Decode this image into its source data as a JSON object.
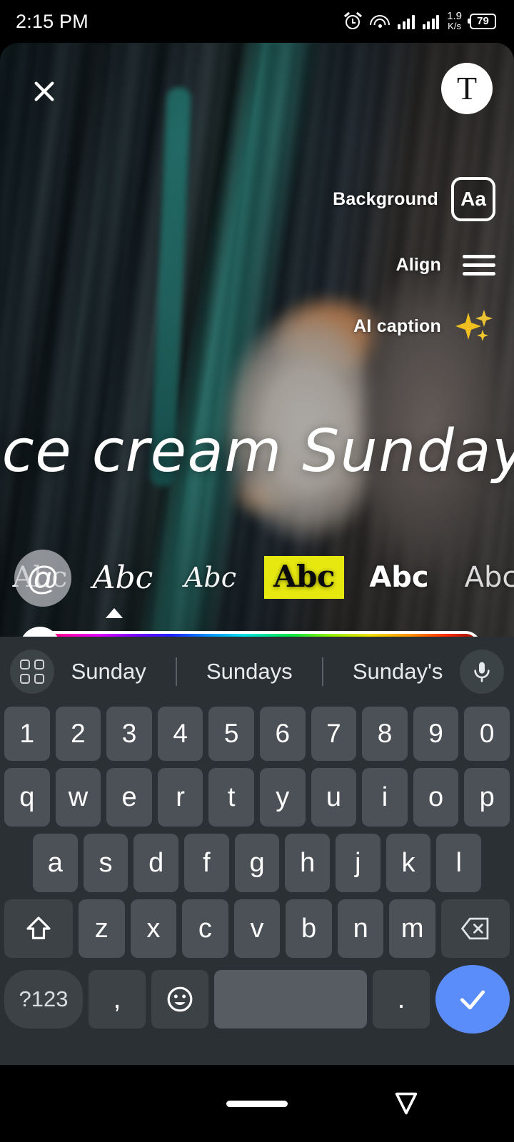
{
  "status_bar": {
    "time": "2:15 PM",
    "alarm_icon": "alarm-icon",
    "wifi_icon": "wifi-icon",
    "signal_icon": "signal-bars-icon",
    "network_speed_value": "1.9",
    "network_speed_unit": "K/s",
    "battery_level": "79"
  },
  "editor": {
    "close_label": "✕",
    "text_tool_label": "T",
    "controls": [
      {
        "label": "Background",
        "icon": "aa-box-icon",
        "icon_text": "Aa"
      },
      {
        "label": "Align",
        "icon": "align-lines-icon"
      },
      {
        "label": "AI caption",
        "icon": "sparkles-icon"
      }
    ],
    "overlay_text": "Ice cream Sunday",
    "cursor_color": "#3d9ac6",
    "mention_button": "@",
    "font_options": [
      {
        "sample": "Abc",
        "style": "serif"
      },
      {
        "sample": "Abc",
        "style": "italic-script"
      },
      {
        "sample": "Abc",
        "style": "cursive"
      },
      {
        "sample": "Abc",
        "style": "highlighted",
        "selected": true,
        "highlight_color": "#e6e80f"
      },
      {
        "sample": "Abc",
        "style": "bold-sans"
      },
      {
        "sample": "Abc",
        "style": "light-sans"
      },
      {
        "sample": "A",
        "style": "clipped"
      }
    ],
    "color_slider": {
      "thumb_position": "left",
      "thumb_color": "#ffffff",
      "gradient": "rainbow"
    }
  },
  "keyboard": {
    "suggestions": [
      "Sunday",
      "Sundays",
      "Sunday's"
    ],
    "grid_icon": "grid-icon",
    "mic_icon": "microphone-icon",
    "rows": {
      "numbers": [
        "1",
        "2",
        "3",
        "4",
        "5",
        "6",
        "7",
        "8",
        "9",
        "0"
      ],
      "top": [
        "q",
        "w",
        "e",
        "r",
        "t",
        "y",
        "u",
        "i",
        "o",
        "p"
      ],
      "home": [
        "a",
        "s",
        "d",
        "f",
        "g",
        "h",
        "j",
        "k",
        "l"
      ],
      "bottom": [
        "z",
        "x",
        "c",
        "v",
        "b",
        "n",
        "m"
      ]
    },
    "shift_icon": "shift-icon",
    "backspace_icon": "backspace-icon",
    "symbols_label": "?123",
    "comma_label": ",",
    "emoji_icon": "emoji-icon",
    "space_label": "",
    "period_label": ".",
    "enter_icon": "checkmark-icon",
    "enter_color": "#5b8dfa"
  },
  "nav_bar": {
    "home_indicator": "home-pill",
    "hide_keyboard_icon": "hide-keyboard-icon"
  }
}
